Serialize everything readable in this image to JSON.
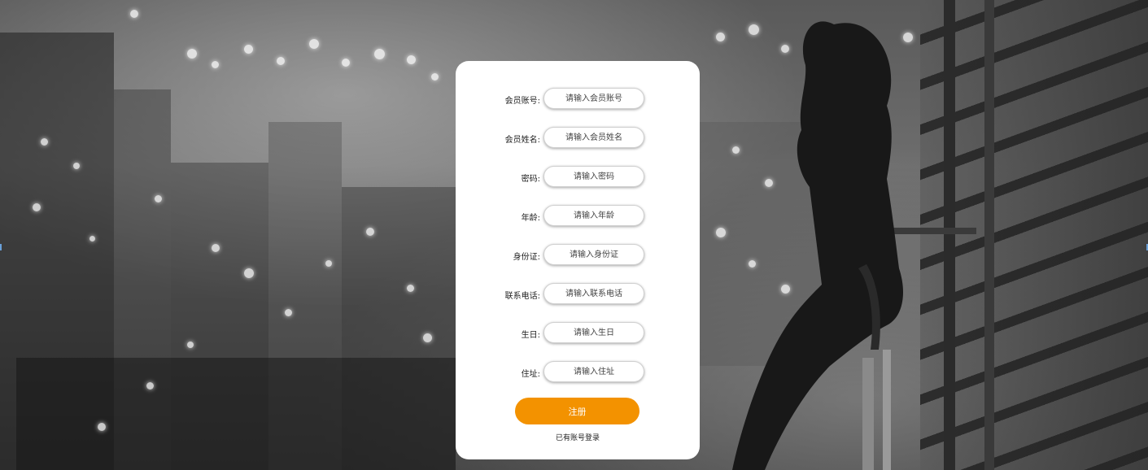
{
  "form": {
    "fields": [
      {
        "label": "会员账号:",
        "placeholder": "请输入会员账号"
      },
      {
        "label": "会员姓名:",
        "placeholder": "请输入会员姓名"
      },
      {
        "label": "密码:",
        "placeholder": "请输入密码"
      },
      {
        "label": "年龄:",
        "placeholder": "请输入年龄"
      },
      {
        "label": "身份证:",
        "placeholder": "请输入身份证"
      },
      {
        "label": "联系电话:",
        "placeholder": "请输入联系电话"
      },
      {
        "label": "生日:",
        "placeholder": "请输入生日"
      },
      {
        "label": "住址:",
        "placeholder": "请输入住址"
      }
    ],
    "submit_label": "注册",
    "login_link": "已有账号登录"
  },
  "colors": {
    "accent": "#f39200",
    "card": "#ffffff"
  }
}
